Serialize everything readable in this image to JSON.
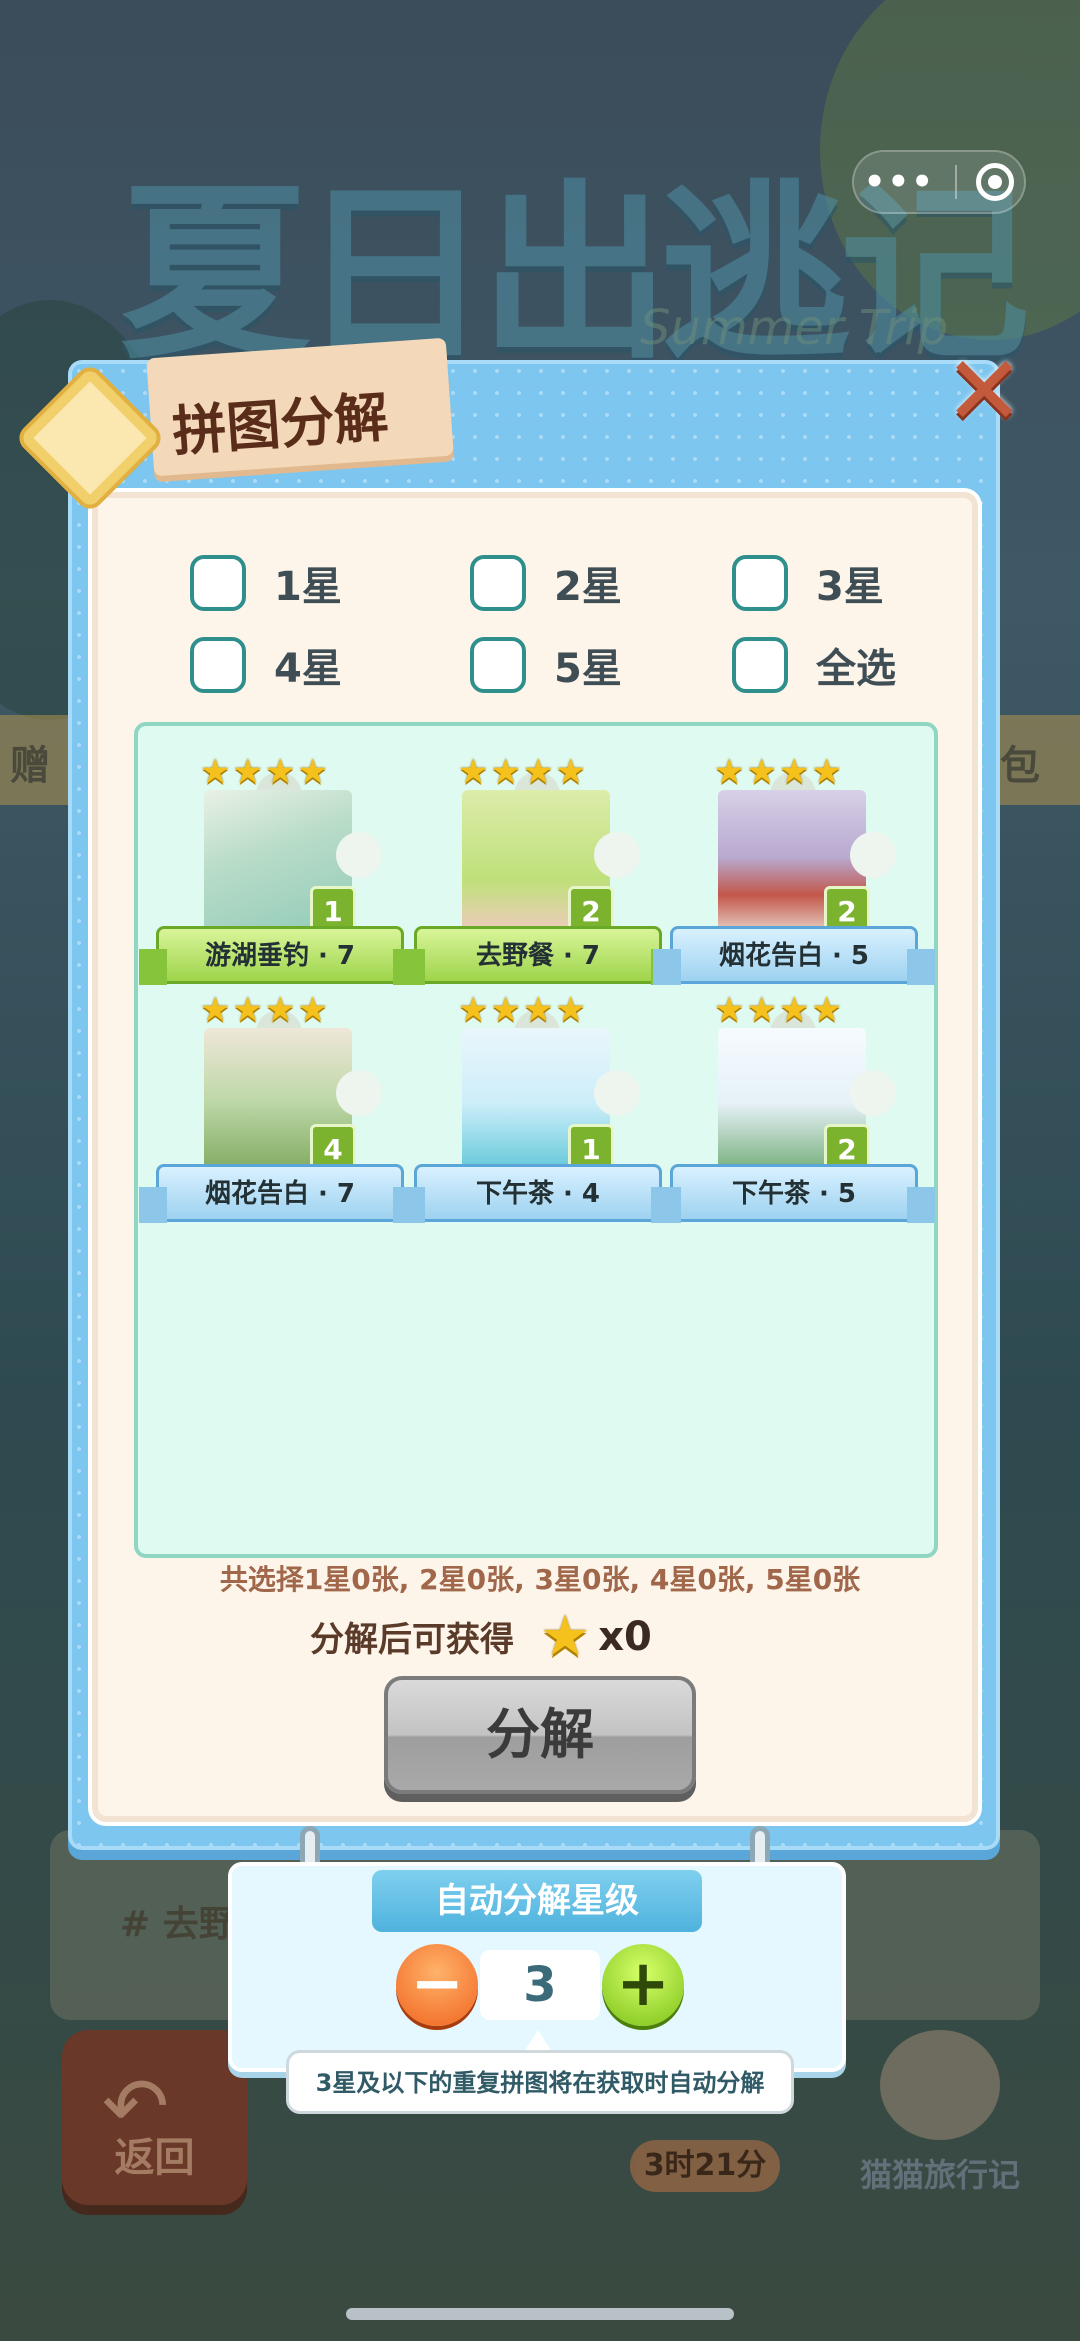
{
  "background": {
    "title": "夏日出逃记",
    "subtitle": "Summer Trip",
    "left_tab": "赠",
    "right_tab": "包",
    "card_text": "# 去野",
    "return_label": "返回",
    "timer": "3时21分",
    "cat_travel": "猫猫旅行记"
  },
  "capsule": {
    "more": "•••"
  },
  "dialog": {
    "title": "拼图分解",
    "close_glyph": "✕",
    "filters": [
      {
        "label": "1星"
      },
      {
        "label": "2星"
      },
      {
        "label": "3星"
      },
      {
        "label": "4星"
      },
      {
        "label": "5星"
      },
      {
        "label": "全选"
      }
    ],
    "puzzles": [
      {
        "name": "游湖垂钓 · 7",
        "stars": 4,
        "count": "1",
        "ribbon": "green",
        "art": "lake"
      },
      {
        "name": "去野餐 · 7",
        "stars": 4,
        "count": "2",
        "ribbon": "green",
        "art": "picnic"
      },
      {
        "name": "烟花告白 · 5",
        "stars": 4,
        "count": "2",
        "ribbon": "blue",
        "art": "city"
      },
      {
        "name": "烟花告白 · 7",
        "stars": 4,
        "count": "4",
        "ribbon": "blue",
        "art": "plant"
      },
      {
        "name": "下午茶 · 4",
        "stars": 4,
        "count": "1",
        "ribbon": "blue",
        "art": "sea"
      },
      {
        "name": "下午茶 · 5",
        "stars": 4,
        "count": "2",
        "ribbon": "blue",
        "art": "tea"
      }
    ],
    "summary": "共选择1星0张, 2星0张, 3星0张, 4星0张, 5星0张",
    "reward_label": "分解后可获得",
    "reward_amount": "x0",
    "decompose_label": "分解"
  },
  "auto": {
    "title": "自动分解星级",
    "level": "3",
    "minus": "−",
    "plus": "+",
    "hint": "3星及以下的重复拼图将在获取时自动分解"
  },
  "colors": {
    "accent_blue": "#7cc6ef",
    "star_gold": "#f5c21d",
    "checkbox_teal": "#2e8f8c"
  }
}
